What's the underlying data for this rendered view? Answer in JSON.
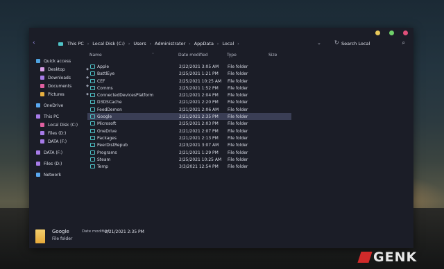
{
  "window_controls": {
    "colors": [
      "#e8c85a",
      "#6fd06a",
      "#e0507a"
    ]
  },
  "address_bar": {
    "back_icon": "back-arrow-icon",
    "crumbs": [
      "This PC",
      "Local Disk (C:)",
      "Users",
      "Administrator",
      "AppData",
      "Local"
    ],
    "search_placeholder": "Search Local"
  },
  "sidebar": {
    "items": [
      {
        "label": "Quick access",
        "color": "#4fa3e0",
        "pinned": false
      },
      {
        "label": "Desktop",
        "color": "#d9a0e8",
        "pinned": true
      },
      {
        "label": "Downloads",
        "color": "#a77be8",
        "pinned": true
      },
      {
        "label": "Documents",
        "color": "#e060a0",
        "pinned": true
      },
      {
        "label": "Pictures",
        "color": "#e8b040",
        "pinned": true
      },
      {
        "label": "OneDrive",
        "color": "#5aa8f0",
        "pinned": false
      },
      {
        "label": "This PC",
        "color": "#a77be8",
        "pinned": false
      },
      {
        "label": "Local Disk (C:)",
        "color": "#e060a0",
        "pinned": false
      },
      {
        "label": "Files (D:)",
        "color": "#a77be8",
        "pinned": false
      },
      {
        "label": "DATA (F:)",
        "color": "#a77be8",
        "pinned": false
      },
      {
        "label": "DATA (F:)",
        "color": "#a77be8",
        "pinned": false
      },
      {
        "label": "Files (D:)",
        "color": "#a77be8",
        "pinned": false
      },
      {
        "label": "Network",
        "color": "#5aa8f0",
        "pinned": false
      }
    ]
  },
  "columns": {
    "name": "Name",
    "date": "Date modified",
    "type": "Type",
    "size": "Size"
  },
  "files": [
    {
      "name": "Apple",
      "date": "2/22/2021 3:05 AM",
      "type": "File folder"
    },
    {
      "name": "BattlEye",
      "date": "2/25/2021 1:21 PM",
      "type": "File folder"
    },
    {
      "name": "CEF",
      "date": "2/25/2021 10:25 AM",
      "type": "File folder"
    },
    {
      "name": "Comms",
      "date": "2/25/2021 1:52 PM",
      "type": "File folder"
    },
    {
      "name": "ConnectedDevicesPlatform",
      "date": "2/21/2021 2:04 PM",
      "type": "File folder"
    },
    {
      "name": "D3DSCache",
      "date": "2/21/2021 2:20 PM",
      "type": "File folder"
    },
    {
      "name": "FeedDemon",
      "date": "2/21/2021 2:06 AM",
      "type": "File folder"
    },
    {
      "name": "Google",
      "date": "2/21/2021 2:35 PM",
      "type": "File folder"
    },
    {
      "name": "Microsoft",
      "date": "2/25/2021 2:03 PM",
      "type": "File folder"
    },
    {
      "name": "OneDrive",
      "date": "2/21/2021 2:07 PM",
      "type": "File folder"
    },
    {
      "name": "Packages",
      "date": "2/21/2021 2:13 PM",
      "type": "File folder"
    },
    {
      "name": "PeerDistRepub",
      "date": "2/23/2021 3:07 AM",
      "type": "File folder"
    },
    {
      "name": "Programs",
      "date": "2/21/2021 1:29 PM",
      "type": "File folder"
    },
    {
      "name": "Steam",
      "date": "2/25/2021 10:25 AM",
      "type": "File folder"
    },
    {
      "name": "Temp",
      "date": "3/3/2021 12:54 PM",
      "type": "File folder"
    }
  ],
  "selected_index": 7,
  "details": {
    "name": "Google",
    "modified_label": "Date modified:",
    "modified_value": "2/21/2021 2:35 PM",
    "type": "File folder"
  },
  "watermark": "GENK"
}
